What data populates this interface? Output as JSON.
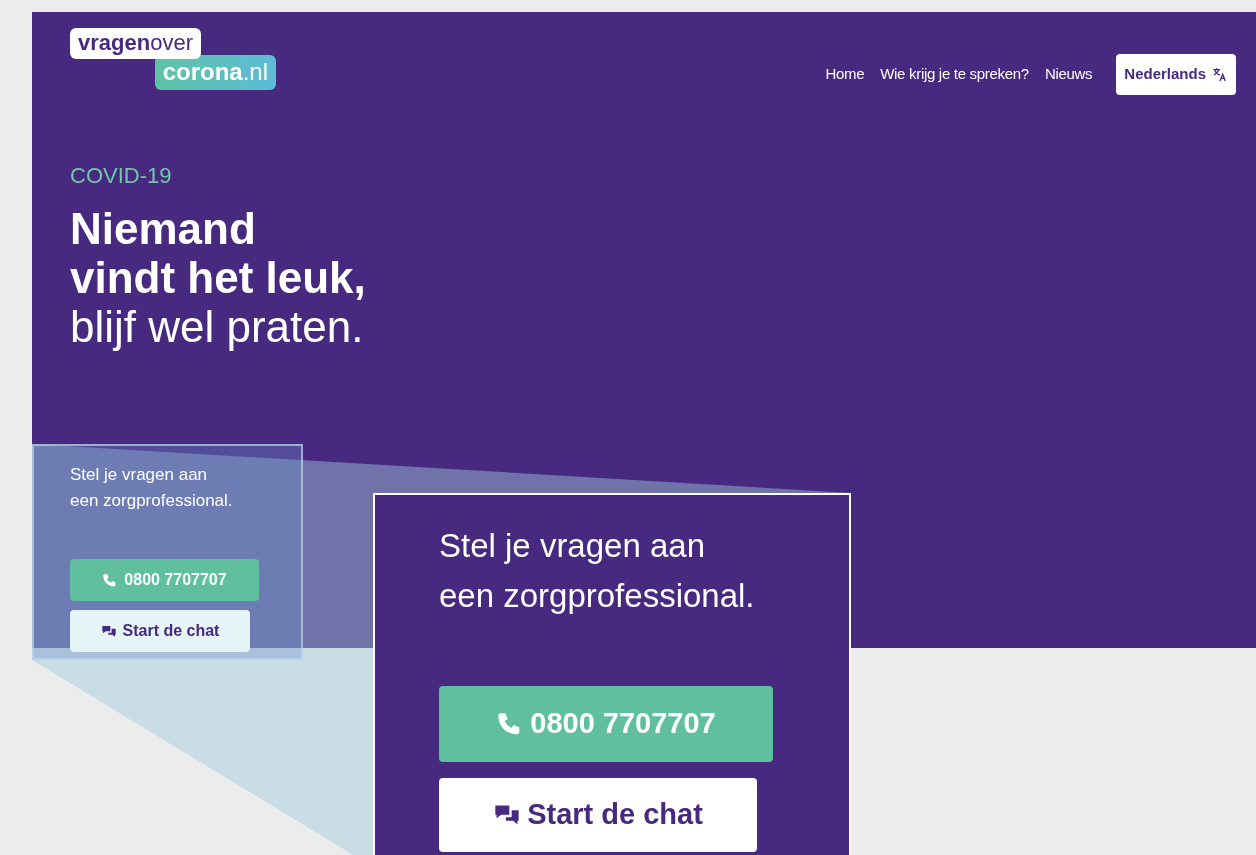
{
  "logo": {
    "line_1": "**vragen**over",
    "line_2": "**corona**.nl"
  },
  "nav": {
    "links": [
      {
        "label": "Home"
      },
      {
        "label": "Wie krijg je te spreken?"
      },
      {
        "label": "Nieuws"
      }
    ],
    "language_button": "Nederlands"
  },
  "hero": {
    "eyebrow": "COVID-19",
    "headline": [
      "**Niemand**",
      "**vindt het leuk,**",
      "blijf wel praten."
    ]
  },
  "contact": {
    "intro": [
      "Stel je vragen aan",
      "een zorgprofessional."
    ],
    "phone_button": "0800 7707707",
    "chat_button": "Start de chat"
  },
  "zoom_callout": {
    "intro": [
      "Stel je vragen aan",
      "een zorgprofessional."
    ],
    "phone_button": "0800 7707707",
    "chat_button": "Start de chat"
  }
}
